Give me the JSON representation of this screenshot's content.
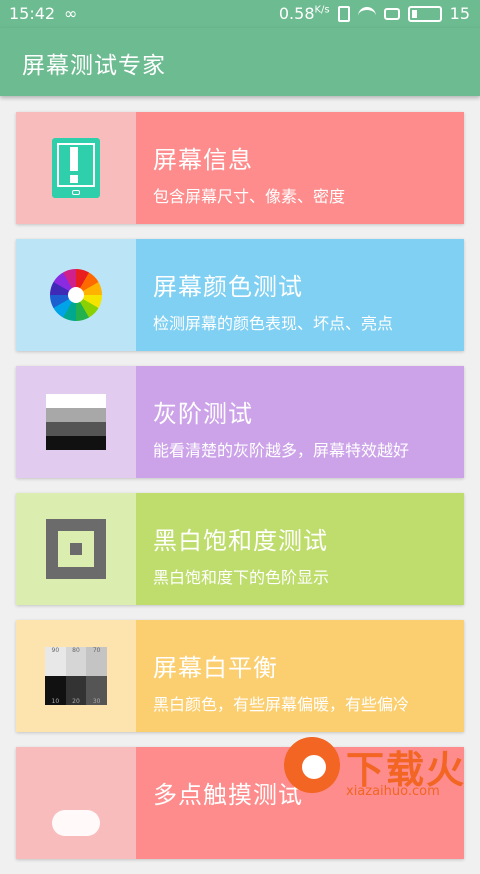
{
  "status_bar": {
    "time": "15:42",
    "loop_icon": "∞",
    "speed_value": "0.58",
    "speed_unit": "K/s",
    "battery": "15"
  },
  "app": {
    "title": "屏幕测试专家"
  },
  "cards": [
    {
      "title": "屏幕信息",
      "desc": "包含屏幕尺寸、像素、密度",
      "icon": "tablet-alert-icon"
    },
    {
      "title": "屏幕颜色测试",
      "desc": "检测屏幕的颜色表现、坏点、亮点",
      "icon": "color-wheel-icon"
    },
    {
      "title": "灰阶测试",
      "desc": "能看清楚的灰阶越多，屏幕特效越好",
      "icon": "grayscale-bars-icon"
    },
    {
      "title": "黑白饱和度测试",
      "desc": "黑白饱和度下的色阶显示",
      "icon": "concentric-squares-icon"
    },
    {
      "title": "屏幕白平衡",
      "desc": "黑白颜色，有些屏幕偏暖，有些偏冷",
      "icon": "white-balance-grid-icon"
    },
    {
      "title": "多点触摸测试",
      "desc": "",
      "icon": "cloud-icon"
    }
  ],
  "white_balance_labels": {
    "top": [
      "90",
      "80",
      "70"
    ],
    "bottom": [
      "10",
      "20",
      "30"
    ]
  },
  "watermark": {
    "text": "下载火",
    "sub": "xiazaihuo.com"
  },
  "colors": {
    "primary": "#6dbb91",
    "card1": "#fe8c8c",
    "card2": "#7fd0f2",
    "card3": "#cca3e9",
    "card4": "#bedd6c",
    "card5": "#fbcf70",
    "watermark": "#f26522"
  }
}
